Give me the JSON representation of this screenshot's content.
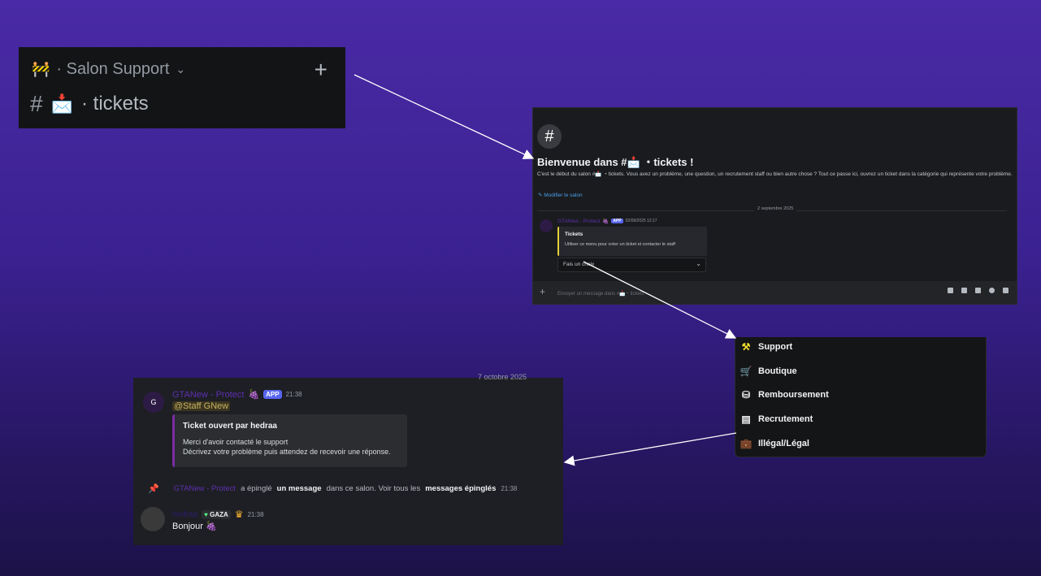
{
  "sidebar": {
    "category_icon": "construction-barrier-icon",
    "category_label": "· Salon Support",
    "category_chevron": "⌄",
    "add_button": "+",
    "channel_hash": "#",
    "channel_icon": "envelope-icon",
    "channel_name": "· tickets"
  },
  "welcome": {
    "hash": "#",
    "title": "Bienvenue dans #📩 ・tickets !",
    "description": "C'est le début du salon #📩 ・tickets. Vous avez un problème, une question, un recrutement staff ou bien autre chose ? Tout ce passe ici, ouvrez un ticket dans la catégorie qui représente votre problème.",
    "edit_link": "✎ Modifier le salon",
    "date_divider": "2 septembre 2025",
    "author": "GTANew - Protect",
    "app_tag": "APP",
    "timestamp": "02/09/2025 12:17",
    "embed_title": "Tickets",
    "embed_desc": "Utiliser ce menu pour créer un ticket et contacter le staff",
    "select_value": "Fais un choix",
    "input_placeholder": "Envoyer un message dans #📩・tickets",
    "plus": "+"
  },
  "menu": {
    "items": [
      {
        "label": "Support",
        "icon": "tools-icon",
        "glyph": "⚒",
        "color": "#f5e12b"
      },
      {
        "label": "Boutique",
        "icon": "cart-icon",
        "glyph": "🛒",
        "color": "#dbdee1"
      },
      {
        "label": "Remboursement",
        "icon": "coins-icon",
        "glyph": "⛁",
        "color": "#dbdee1"
      },
      {
        "label": "Recrutement",
        "icon": "document-icon",
        "glyph": "▤",
        "color": "#dbdee1"
      },
      {
        "label": "Illégal/Légal",
        "icon": "briefcase-icon",
        "glyph": "💼",
        "color": "#4a9ee8"
      }
    ]
  },
  "ticket": {
    "top_date": "7 octobre 2025",
    "author": "GTANew - Protect",
    "app_tag": "APP",
    "timestamp": "21:38",
    "mention": "@Staff GNew",
    "embed_title": "Ticket ouvert par hedraa",
    "embed_line1": "Merci d'avoir contacté le support",
    "embed_line2": "Décrivez votre problème puis attendez de recevoir une réponse.",
    "pin_author": "GTANew - Protect",
    "pin_text1": "a épinglé",
    "pin_text2": "un message",
    "pin_text3": "dans ce salon. Voir tous les",
    "pin_text4": "messages épinglés",
    "pin_ts": "21:38",
    "user": "hedraa",
    "user_tag": "GAZA",
    "user_ts": "21:38",
    "message": "Bonjour"
  },
  "colors": {
    "accent": "#5865f2",
    "app_name": "#5d2fb0",
    "embed_border_yellow": "#e3d03a",
    "embed_border_purple": "#7b2ca6"
  }
}
